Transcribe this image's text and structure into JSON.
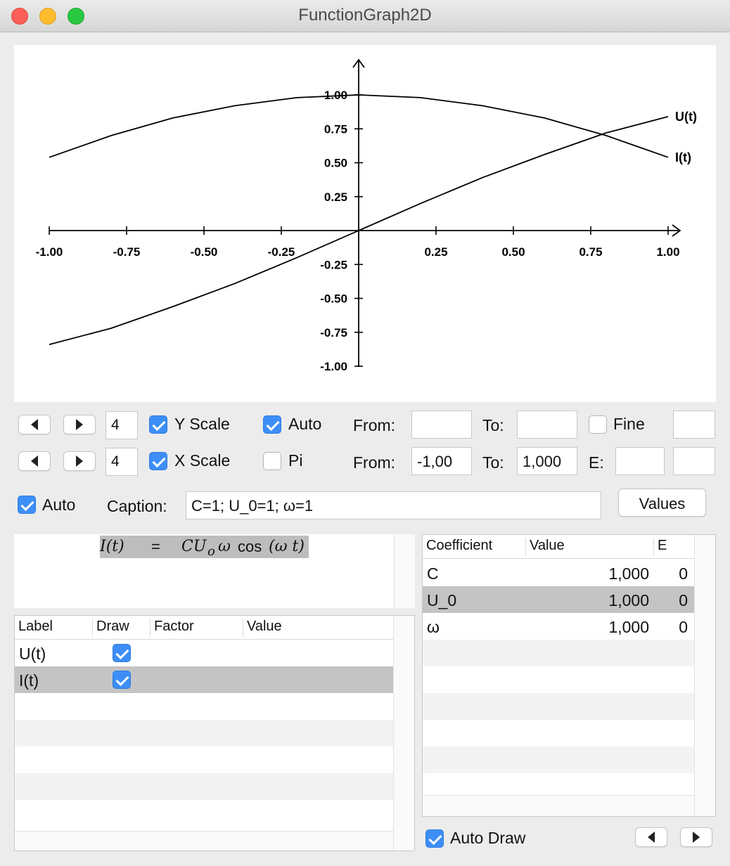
{
  "window": {
    "title": "FunctionGraph2D"
  },
  "chart_data": {
    "type": "line",
    "xlim": [
      -1,
      1
    ],
    "ylim": [
      -1,
      1
    ],
    "x_ticks": [
      "-1.00",
      "-0.75",
      "-0.50",
      "-0.25",
      "0.25",
      "0.50",
      "0.75",
      "1.00"
    ],
    "y_ticks": [
      "1.00",
      "0.75",
      "0.50",
      "0.25",
      "-0.25",
      "-0.50",
      "-0.75",
      "-1.00"
    ],
    "series": [
      {
        "name": "U(t)",
        "x": [
          -1.0,
          -0.8,
          -0.6,
          -0.4,
          -0.2,
          0.0,
          0.2,
          0.4,
          0.6,
          0.8,
          1.0
        ],
        "y": [
          -0.84,
          -0.72,
          -0.56,
          -0.39,
          -0.2,
          0.0,
          0.2,
          0.39,
          0.56,
          0.72,
          0.84
        ]
      },
      {
        "name": "I(t)",
        "x": [
          -1.0,
          -0.8,
          -0.6,
          -0.4,
          -0.2,
          0.0,
          0.2,
          0.4,
          0.6,
          0.8,
          1.0
        ],
        "y": [
          0.54,
          0.7,
          0.83,
          0.92,
          0.98,
          1.0,
          0.98,
          0.92,
          0.83,
          0.7,
          0.54
        ]
      }
    ],
    "grid": false
  },
  "y_scale": {
    "steps": "4",
    "checkbox_label": "Y Scale",
    "checked": true,
    "auto_label": "Auto",
    "auto_checked": true,
    "from_label": "From:",
    "from_value": "",
    "to_label": "To:",
    "to_value": "",
    "fine_label": "Fine",
    "fine_checked": false,
    "extra_value": ""
  },
  "x_scale": {
    "steps": "4",
    "checkbox_label": "X Scale",
    "checked": true,
    "pi_label": "Pi",
    "pi_checked": false,
    "from_label": "From:",
    "from_value": "-1,00",
    "to_label": "To:",
    "to_value": "1,000",
    "e_label": "E:",
    "e_value": "",
    "extra_value": ""
  },
  "caption": {
    "auto_label": "Auto",
    "auto_checked": true,
    "label": "Caption:",
    "value": "C=1; U_0=1; ω=1",
    "values_button": "Values"
  },
  "formula": {
    "lhs": "I(t)",
    "eq": "=",
    "coef": "CU",
    "sub": "o",
    "omega": "ω",
    "func": "cos",
    "arg": "(ω t)"
  },
  "curves_table": {
    "columns": [
      "Label",
      "Draw",
      "Factor",
      "Value"
    ],
    "rows": [
      {
        "label": "U(t)",
        "draw": true,
        "factor": "",
        "value": ""
      },
      {
        "label": "I(t)",
        "draw": true,
        "factor": "",
        "value": ""
      }
    ]
  },
  "coef_table": {
    "columns": [
      "Coefficient",
      "Value",
      "E"
    ],
    "rows": [
      {
        "name": "C",
        "value": "1,000",
        "e": "0"
      },
      {
        "name": "U_0",
        "value": "1,000",
        "e": "0"
      },
      {
        "name": "ω",
        "value": "1,000",
        "e": "0"
      }
    ]
  },
  "auto_draw": {
    "label": "Auto Draw",
    "checked": true
  }
}
